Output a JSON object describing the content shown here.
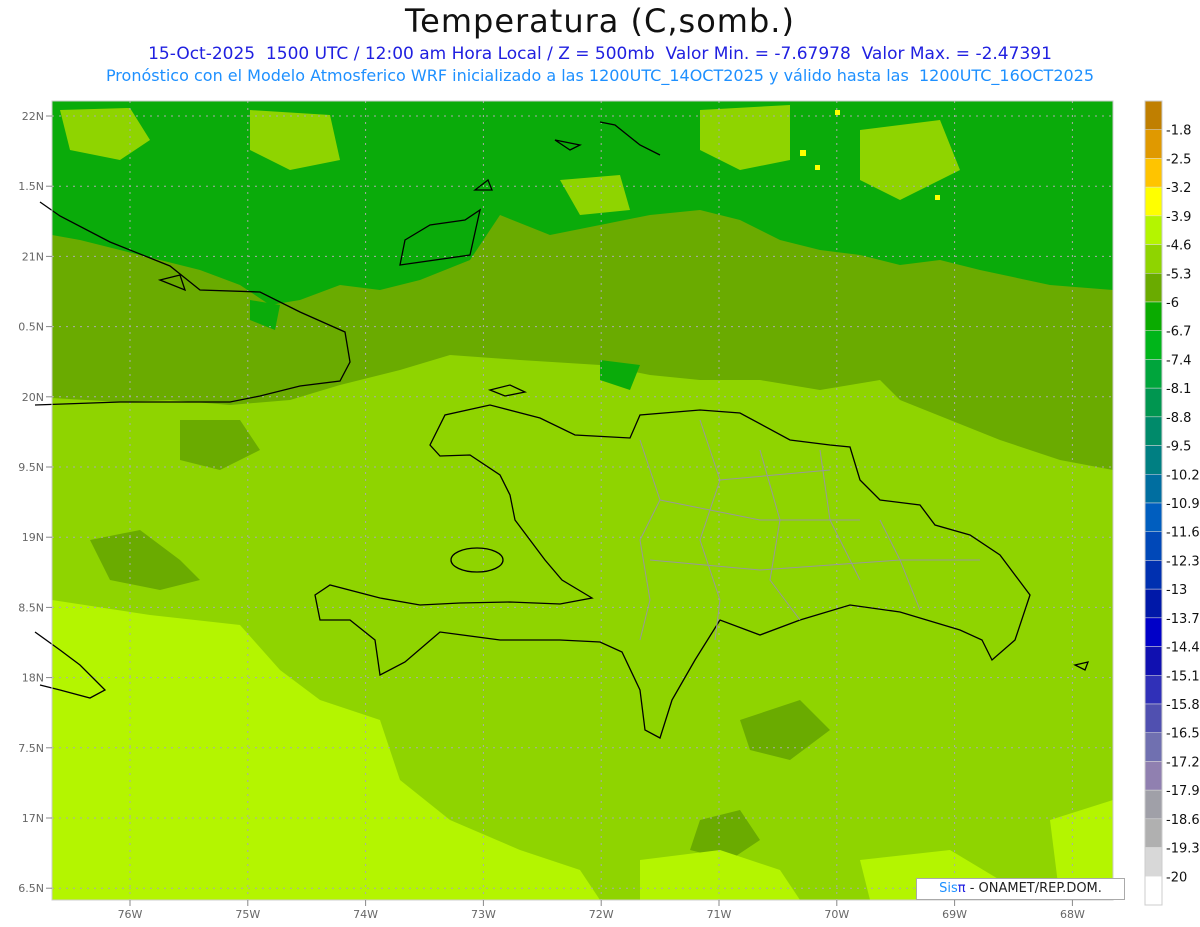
{
  "header": {
    "title": "Temperatura (C,somb.)",
    "line1": "15-Oct-2025  1500 UTC / 12:00 am Hora Local / Z = 500mb  Valor Min. = -7.67978  Valor Max. = -2.47391",
    "line2": "Pronóstico con el Modelo Atmosferico WRF inicializado a las 1200UTC_14OCT2025 y válido hasta las  1200UTC_16OCT2025"
  },
  "axes": {
    "lat_labels": [
      "22N",
      "1.5N",
      "21N",
      "0.5N",
      "20N",
      "9.5N",
      "19N",
      "8.5N",
      "18N",
      "7.5N",
      "17N",
      "6.5N"
    ],
    "lon_labels": [
      "76W",
      "75W",
      "74W",
      "73W",
      "72W",
      "71W",
      "70W",
      "69W",
      "68W"
    ]
  },
  "colorbar": {
    "colors": [
      "#c07f00",
      "#e09900",
      "#ffc400",
      "#ffff00",
      "#b4f500",
      "#8fd400",
      "#6aab00",
      "#0aab00",
      "#00b51a",
      "#00a53c",
      "#009650",
      "#008a6a",
      "#007f82",
      "#006ea0",
      "#005ebf",
      "#0048b8",
      "#0030b0",
      "#0018a8",
      "#0000c8",
      "#1010b0",
      "#3030b8",
      "#5050b0",
      "#7070b0",
      "#9080b0",
      "#a0a0a8",
      "#b0b0b0",
      "#d8d8d8",
      "#ffffff"
    ],
    "labels": [
      "-1.8",
      "-2.5",
      "-3.2",
      "-3.9",
      "-4.6",
      "-5.3",
      "-6",
      "-6.7",
      "-7.4",
      "-8.1",
      "-8.8",
      "-9.5",
      "-10.2",
      "-10.9",
      "-11.6",
      "-12.3",
      "-13",
      "-13.7",
      "-14.4",
      "-15.1",
      "-15.8",
      "-16.5",
      "-17.2",
      "-17.9",
      "-18.6",
      "-19.3",
      "-20"
    ]
  },
  "field_colors": {
    "dark": "#0aab0a",
    "olive": "#6aab00",
    "light": "#8fd400",
    "yellow": "#b4f500"
  },
  "credit": {
    "sis": "Sis",
    "pi": "π",
    "rest": " - ONAMET/REP.DOM."
  }
}
